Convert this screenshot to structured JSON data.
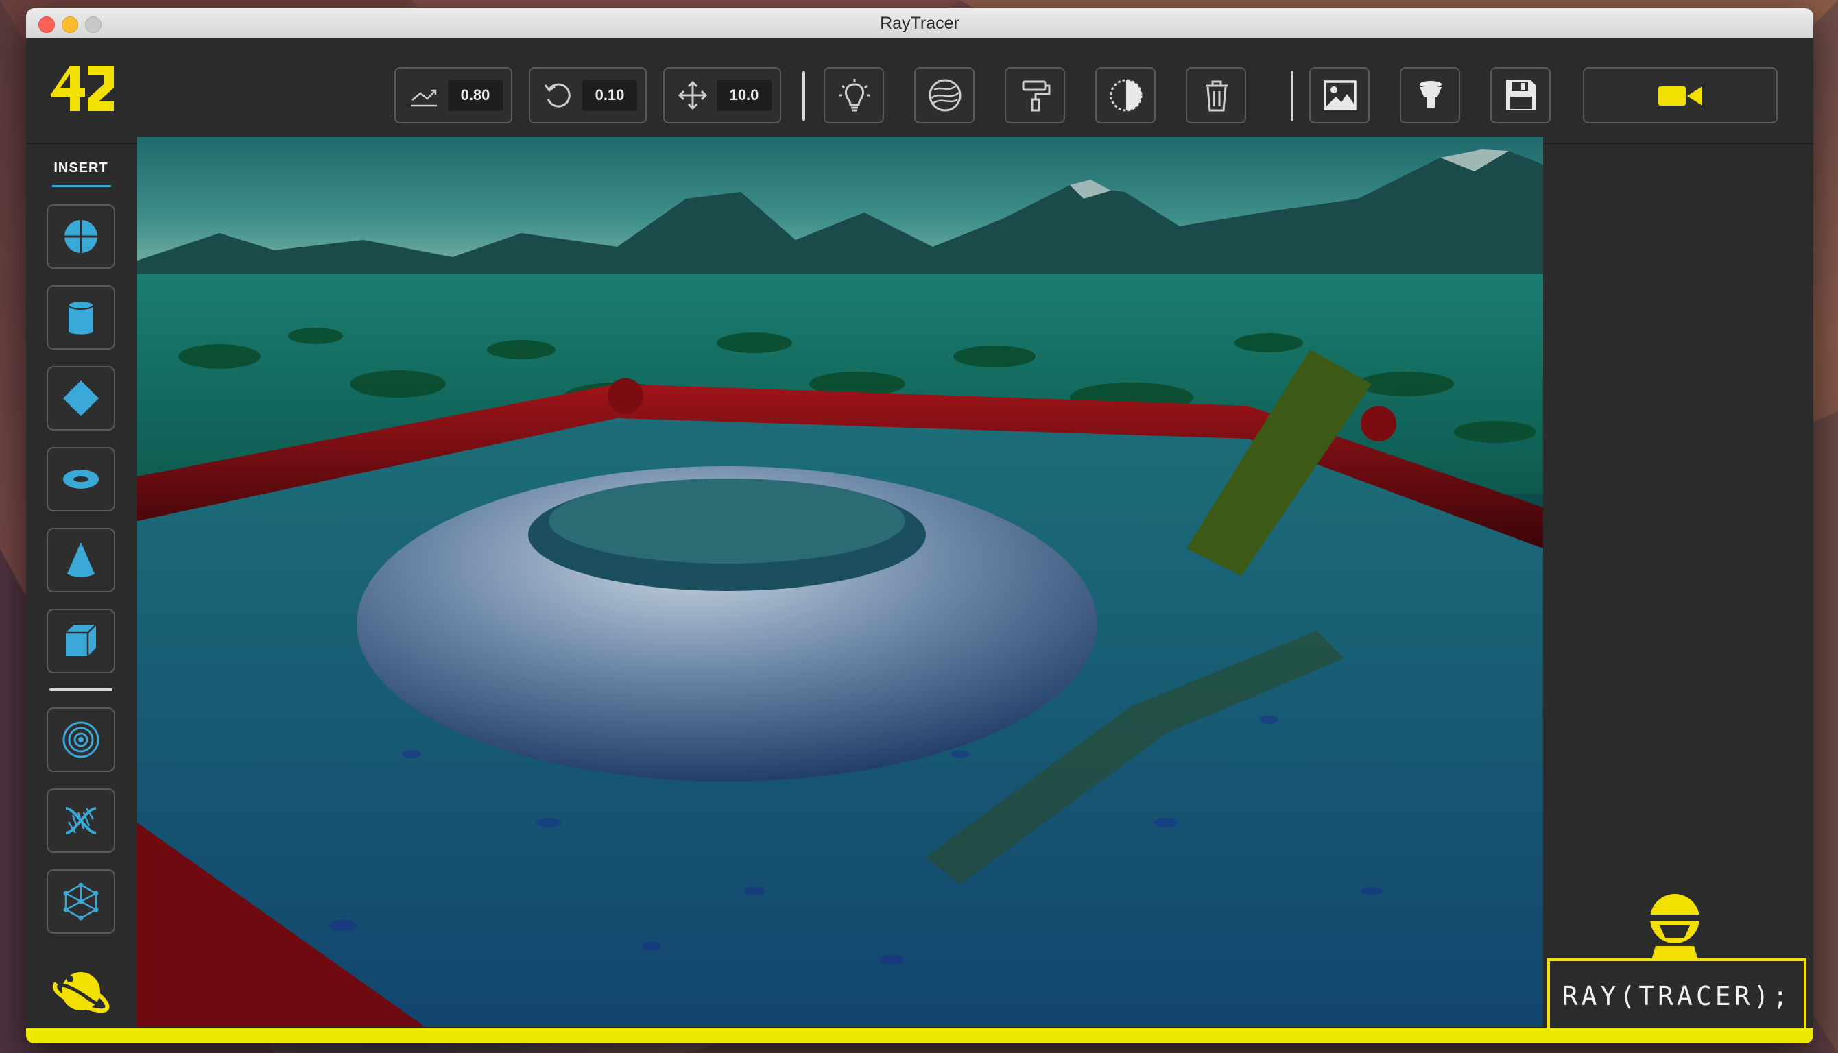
{
  "window": {
    "title": "RayTracer"
  },
  "toolbar": {
    "value_controls": [
      {
        "name": "scale",
        "icon": "scale-icon",
        "value": "0.80"
      },
      {
        "name": "rotate",
        "icon": "rotate-icon",
        "value": "0.10"
      },
      {
        "name": "move",
        "icon": "move-icon",
        "value": "10.0"
      }
    ],
    "tools": [
      "light-bulb-icon",
      "texture-sphere-icon",
      "paint-roller-icon",
      "contrast-icon",
      "trash-icon"
    ],
    "file_tools": [
      "image-icon",
      "filter-icon",
      "save-icon"
    ],
    "camera_icon": "video-camera-icon"
  },
  "sidebar": {
    "heading": "INSERT",
    "shapes": [
      "sphere-icon",
      "cylinder-icon",
      "plane-icon",
      "torus-icon",
      "cone-icon",
      "cube-icon"
    ],
    "special": [
      "concentric-rings-icon",
      "dna-icon",
      "network-icon"
    ],
    "bottom_icon": "saturn-icon"
  },
  "console": {
    "text": "RAY(TRACER);"
  },
  "colors": {
    "accent": "#f2e000",
    "ui_blue": "#3aa9d8",
    "frame": "#2b2b2b"
  },
  "render": {
    "progress": 1.0
  }
}
